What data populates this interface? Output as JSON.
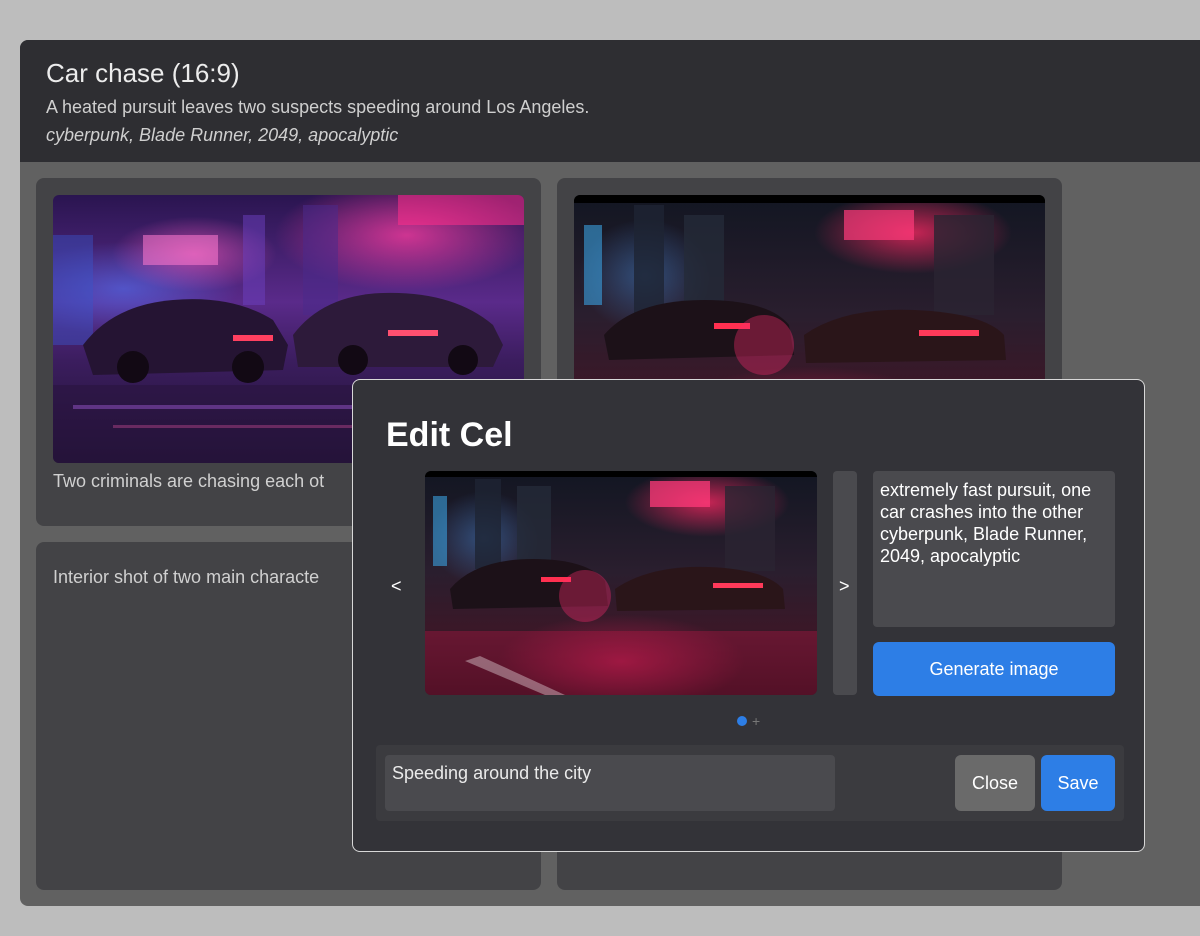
{
  "board": {
    "title": "Car chase (16:9)",
    "description": "A heated pursuit leaves two suspects speeding around Los Angeles.",
    "tags": "cyberpunk, Blade Runner, 2049, apocalyptic"
  },
  "cels": [
    {
      "caption": "Two criminals are chasing each ot"
    },
    {
      "caption": ""
    },
    {
      "caption": "Interior shot of two main characte"
    },
    {
      "caption": ""
    }
  ],
  "modal": {
    "title": "Edit Cel",
    "prev_label": "<",
    "next_label": ">",
    "prompt": "extremely fast pursuit, one car crashes into the other cyberpunk, Blade Runner, 2049, apocalyptic",
    "generate_label": "Generate image",
    "add_label": "+",
    "caption_value": "Speeding around the city",
    "close_label": "Close",
    "save_label": "Save"
  },
  "colors": {
    "accent": "#2d7ee6",
    "header_bg": "#2e2e32",
    "board_bg": "#616161",
    "modal_bg": "#333338"
  }
}
